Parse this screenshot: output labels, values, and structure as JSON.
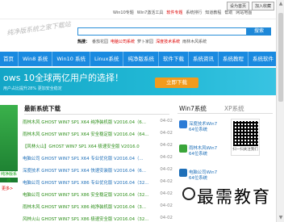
{
  "topbar": {
    "links": [
      {
        "label": "Win10专题",
        "red": false
      },
      {
        "label": "Win7激活工具",
        "red": false
      },
      {
        "label": "软件专题",
        "red": true
      },
      {
        "label": "系统排行",
        "red": false
      },
      {
        "label": "知道教程",
        "red": false
      },
      {
        "label": "帮助",
        "red": false
      },
      {
        "label": "网站地图",
        "red": false
      }
    ],
    "buttons": [
      "设为首页",
      "加入收藏"
    ]
  },
  "logo_script": "纯净版系统之家下载站",
  "search": {
    "hot_label": "热搜：",
    "hot_terms": [
      "番茄花园",
      "电脑公司系统",
      "萝卜家园",
      "深度技术系统",
      "雨林木风系统"
    ],
    "button": "搜索"
  },
  "nav": {
    "items": [
      "首页",
      "Win8 系统",
      "Win10 系统",
      "Linux系统",
      "纯净版系统",
      "软件下载",
      "系统资讯",
      "系统教程",
      "系统软件"
    ]
  },
  "banner": {
    "title": "ows 10全球两亿用户的选择！",
    "subtitle": "用户占比提升28%  更加安全稳定",
    "download": "立即下载"
  },
  "left": {
    "sign": "纯净版系统",
    "more": "更多>"
  },
  "list": {
    "title": "最新系统下载",
    "rows": [
      {
        "title": "雨林木风 GHOST WIN7 SP1 X64 纯净装机版 V2016.04（6...",
        "date": "04-02",
        "color": "green"
      },
      {
        "title": "雨林木风 GHOST WIN7 SP1 X64 安全稳定版 V2016.04（64...",
        "date": "04-02",
        "color": "green"
      },
      {
        "title": "【风林火山】GHOST WIN7 SP1 X64 极速安全版 V2016.0",
        "date": "04-02",
        "color": "green"
      },
      {
        "title": "电脑公司 GHOST WIN7 SP1 X64 专业优化版 V2016.04（...",
        "date": "04-02",
        "color": "blue"
      },
      {
        "title": "深度技术 GHOST WIN7 SP1 X64 快速安装版 V2016.04（6...",
        "date": "04-02",
        "color": "blue"
      },
      {
        "title": "电脑公司 GHOST WIN7 SP1 X86 专业优化版 V2016.04（32...",
        "date": "04-02",
        "color": "blue"
      },
      {
        "title": "电脑公司 GHOST WIN7 SP1 X86 安全稳定版 V2016.04（32...",
        "date": "04-02",
        "color": "green"
      },
      {
        "title": "雨林木风 GHOST WIN7 SP1 X86 纯净装机版 V2016.04（3...",
        "date": "04-02",
        "color": "green"
      },
      {
        "title": "风林火山 GHOST WIN7 SP1 X86 极速安全版 V2016.04（32...",
        "date": "04-02",
        "color": "green"
      }
    ]
  },
  "side": {
    "tab1": "Win7系统",
    "tab2": "XP系统",
    "items": [
      {
        "line1": "深度技术Win7",
        "line2": "64位系统",
        "color": "#2b7bd6"
      },
      {
        "line1": "雨林木风Win7",
        "line2": "64位系统",
        "color": "#3aa53a"
      },
      {
        "line1": "电脑公司Win7",
        "line2": "64位系统",
        "color": "#1e6fb8"
      }
    ],
    "qr_caption": "扫一扫关注我们"
  },
  "watermark": "最需教育"
}
